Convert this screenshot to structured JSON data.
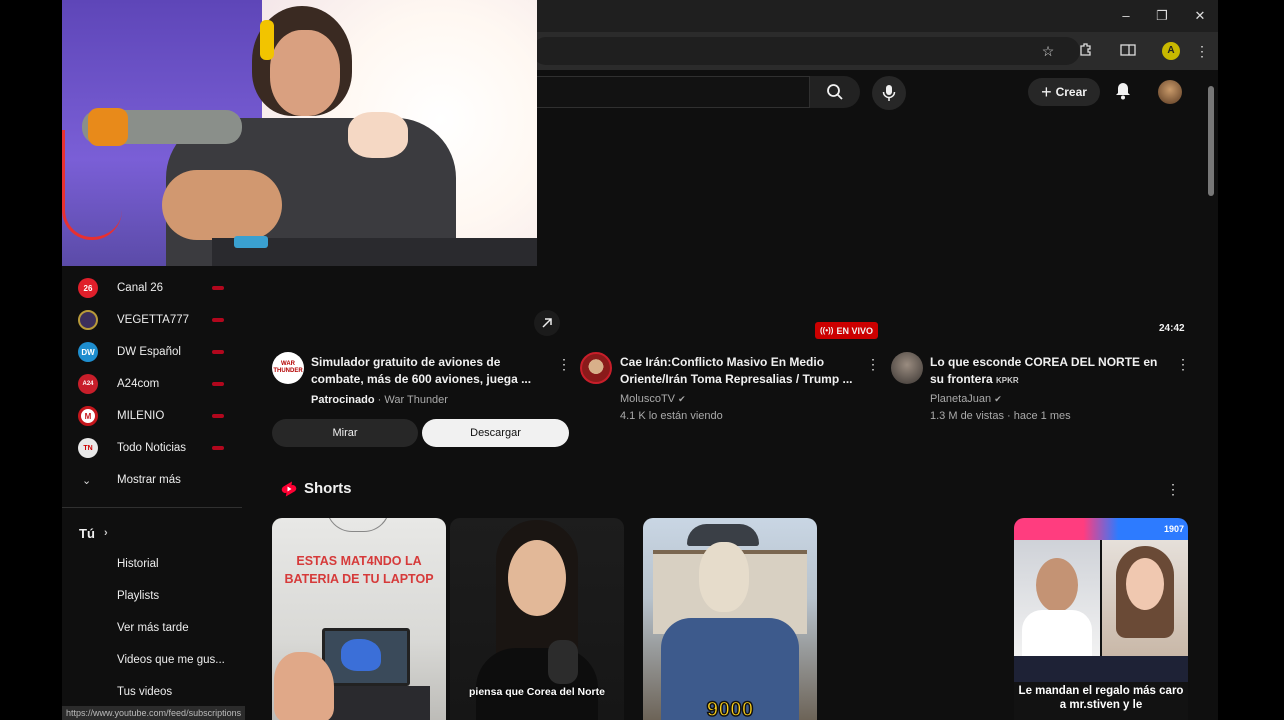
{
  "sidebar": {
    "channels": [
      {
        "label": "Canal 26",
        "icon": "canal26-logo",
        "icon_text": "26",
        "color": "#e01f2b"
      },
      {
        "label": "VEGETTA777",
        "icon": "vegetta-logo",
        "icon_text": "",
        "color": "#3c2f5c"
      },
      {
        "label": "DW Español",
        "icon": "dw-logo",
        "icon_text": "DW",
        "color": "#1e8ecf"
      },
      {
        "label": "A24com",
        "icon": "a24-logo",
        "icon_text": "A24",
        "color": "#c81e2a"
      },
      {
        "label": "MILENIO",
        "icon": "milenio-logo",
        "icon_text": "M",
        "color": "#c4161c"
      },
      {
        "label": "Todo Noticias",
        "icon": "tn-logo",
        "icon_text": "TN",
        "color": "#e8e8e8"
      }
    ],
    "show_more": "Mostrar más",
    "you_section": "Tú",
    "you_items": [
      "Historial",
      "Playlists",
      "Ver más tarde",
      "Videos que me gus...",
      "Tus videos"
    ]
  },
  "header": {
    "create_label": "Crear"
  },
  "videos": [
    {
      "title": "Simulador gratuito de aviones de combate, más de 600 aviones, juega ...",
      "meta_sponsored": "Patrocinado",
      "meta_channel": "War Thunder",
      "channel_icon_text": "WAR THUNDER"
    },
    {
      "badge": "EN VIVO",
      "title": "Cae Irán:Conflicto Masivo En Medio Oriente/Irán Toma Represalias / Trump ...",
      "channel": "MoluscoTV",
      "meta": "4.1 K lo están viendo"
    },
    {
      "duration": "24:42",
      "title": "Lo que esconde COREA DEL NORTE en su frontera",
      "title_tag": "KPKR",
      "channel": "PlanetaJuan",
      "meta": "1.3 M de vistas · hace 1 mes"
    }
  ],
  "ad_buttons": {
    "watch": "Mirar",
    "download": "Descargar"
  },
  "shorts": {
    "heading": "Shorts",
    "items": [
      {
        "overlay_text": "ESTAS MAT4NDO LA BATERIA DE TU LAPTOP"
      },
      {
        "caption": "piensa que Corea del Norte"
      },
      {
        "caption": "9000"
      },
      {
        "caption": "Le mandan el regalo más caro a mr.stiven y le",
        "counter": "1907"
      }
    ]
  },
  "status_url": "https://www.youtube.com/feed/subscriptions"
}
